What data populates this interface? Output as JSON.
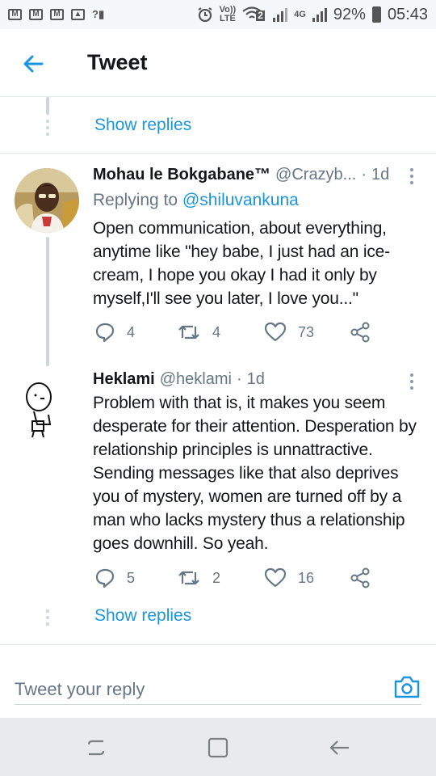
{
  "status_bar": {
    "battery": "92%",
    "time": "05:43",
    "volte": "Vo))",
    "lte": "LTE",
    "network": "4G",
    "sim_slot": "2",
    "icons": [
      "gmail-icon",
      "gmail-icon",
      "gmail-icon",
      "gallery-icon",
      "no-signal-icon",
      "alarm-icon",
      "volte-icon",
      "wifi-icon",
      "signal-icon",
      "battery-icon"
    ]
  },
  "header": {
    "title": "Tweet",
    "back_icon": "arrow-left-icon"
  },
  "thread": {
    "show_replies_top": "Show replies",
    "show_replies_bottom": "Show replies"
  },
  "tweets": [
    {
      "display_name": "Mohau le Bokgabane™",
      "handle": "@Crazyb...",
      "separator": "·",
      "time": "1d",
      "replying_prefix": "Replying to",
      "replying_to": "@shiluvankuna",
      "text": "Open communication, about everything, anytime like \"hey babe, I just had an ice-cream, I hope you okay I had it only by myself,I'll see you later, I love you...\"",
      "replies": "4",
      "retweets": "4",
      "likes": "73"
    },
    {
      "display_name": "Heklami",
      "handle": "@heklami",
      "separator": "·",
      "time": "1d",
      "text": "Problem with that is, it makes you seem desperate for their attention. Desperation by relationship principles is unnattractive. Sending messages like that also deprives you of mystery, women are turned off by a man who lacks mystery thus a relationship goes downhill. So yeah.",
      "replies": "5",
      "retweets": "2",
      "likes": "16"
    }
  ],
  "reply_bar": {
    "placeholder": "Tweet your reply"
  },
  "colors": {
    "accent": "#1b95e0",
    "text": "#14171a",
    "secondary": "#657786",
    "divider": "#e1e8ed"
  }
}
